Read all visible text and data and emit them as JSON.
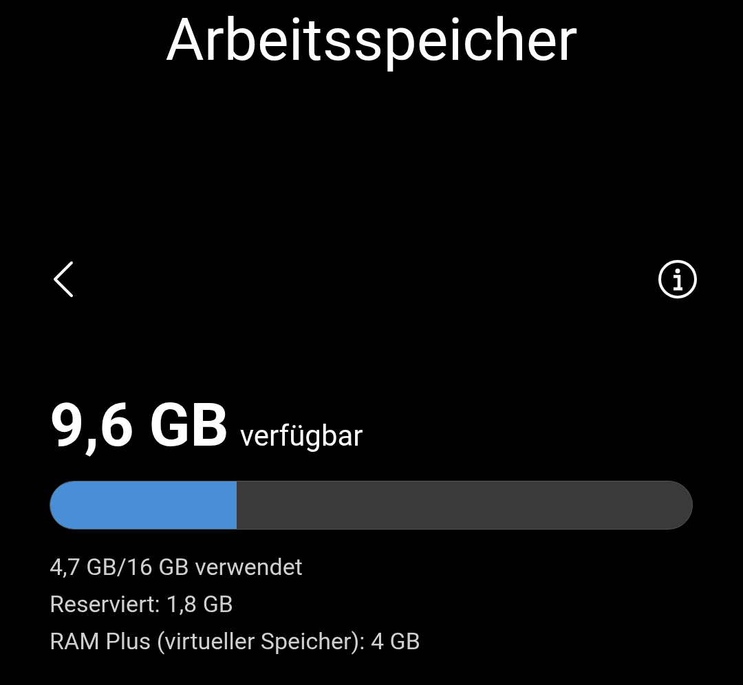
{
  "title": "Arbeitsspeicher",
  "memory": {
    "available": "9,6 GB",
    "available_label": "verfügbar",
    "level": 0.29,
    "details": [
      "4,7 GB/16 GB verwendet",
      "Reserviert: 1,8 GB",
      "RAM Plus (virtueller Speicher): 4 GB"
    ]
  }
}
